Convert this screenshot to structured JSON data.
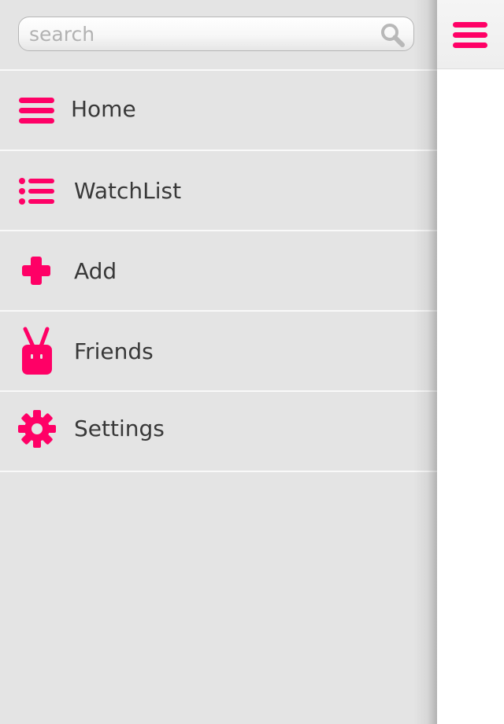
{
  "search": {
    "placeholder": "search",
    "value": "",
    "icon": "search-icon"
  },
  "menu": {
    "items": [
      {
        "label": "Home",
        "icon": "hamburger-icon"
      },
      {
        "label": "WatchList",
        "icon": "list-icon"
      },
      {
        "label": "Add",
        "icon": "plus-icon"
      },
      {
        "label": "Friends",
        "icon": "tv-robot-icon"
      },
      {
        "label": "Settings",
        "icon": "gear-icon"
      }
    ]
  },
  "topbar": {
    "toggle_icon": "hamburger-icon"
  },
  "colors": {
    "accent": "#ff0066",
    "drawer_bg": "#e4e4e4",
    "divider": "#f9f9f9",
    "label_text": "#383838",
    "placeholder_text": "#b2b2b2"
  }
}
